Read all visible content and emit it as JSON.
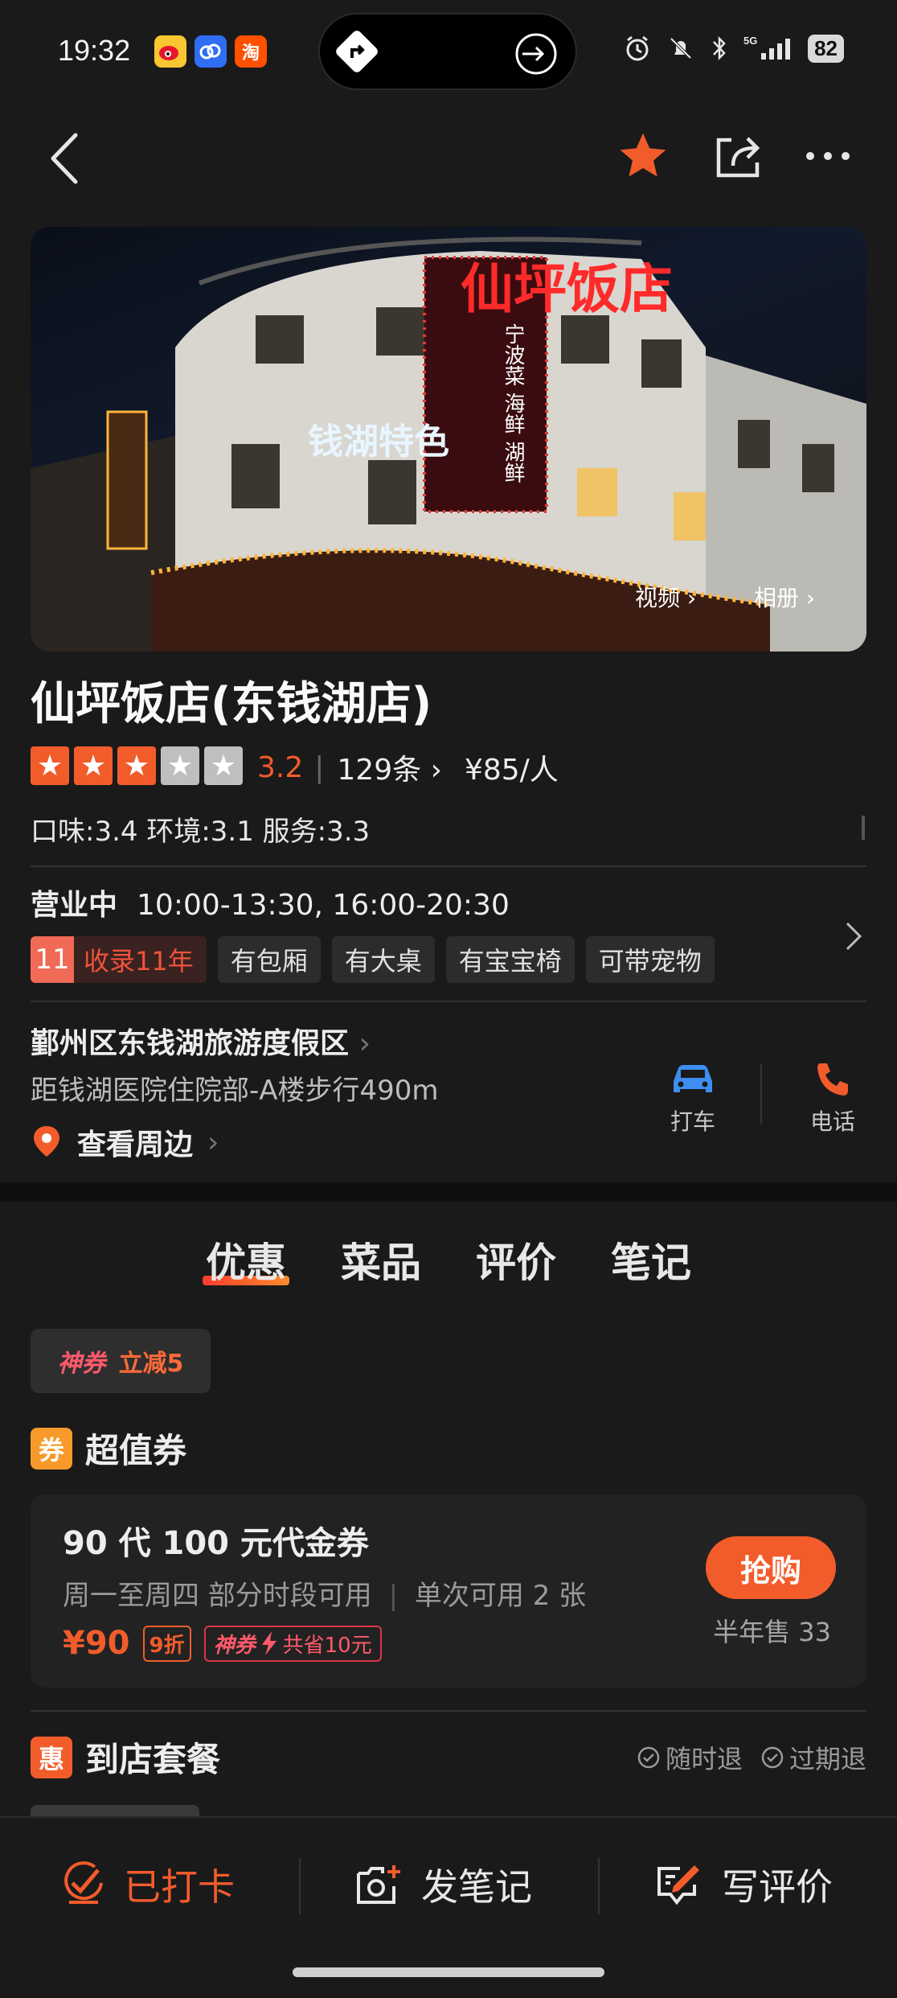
{
  "status_bar": {
    "time": "19:32",
    "app_icons": [
      "weibo-icon",
      "baidu-icon",
      "taobao-icon"
    ],
    "taobao_glyph": "淘",
    "battery": "82",
    "network": "5G"
  },
  "nav": {
    "favorited": true
  },
  "hero": {
    "video_label": "视频",
    "album_label": "相册",
    "sign_text": "仙坪饭店",
    "sign_sub": "宁波菜 海鲜 湖鲜",
    "banner_text": "钱湖特色"
  },
  "shop": {
    "name": "仙坪饭店(东钱湖店)",
    "rating": "3.2",
    "stars": 3,
    "review_count": "129条",
    "price": "¥85/人",
    "sub_scores": "口味:3.4  环境:3.1  服务:3.3",
    "status": "营业中",
    "hours": "10:00-13:30, 16:00-20:30",
    "tags": [
      {
        "num": "11",
        "label": "收录11年"
      },
      {
        "label": "有包厢"
      },
      {
        "label": "有大桌"
      },
      {
        "label": "有宝宝椅"
      },
      {
        "label": "可带宠物"
      }
    ],
    "address": "鄞州区东钱湖旅游度假区",
    "distance": "距钱湖医院住院部-A楼步行490m",
    "nearby": "查看周边",
    "taxi_label": "打车",
    "phone_label": "电话"
  },
  "tabs": [
    {
      "label": "优惠",
      "active": true
    },
    {
      "label": "菜品",
      "active": false
    },
    {
      "label": "评价",
      "active": false
    },
    {
      "label": "笔记",
      "active": false
    }
  ],
  "coupon_chip": {
    "brand": "神券",
    "offer": "立减5"
  },
  "voucher_section": {
    "badge": "券",
    "title": "超值券",
    "item": {
      "name": "90 代 100 元代金券",
      "availability": "周一至周四 部分时段可用",
      "limit": "单次可用 2 张",
      "price": "¥90",
      "discount": "9折",
      "coupon_brand": "神券",
      "savings": "共省10元",
      "buy_label": "抢购",
      "sold": "半年售 33"
    }
  },
  "package_section": {
    "badge": "惠",
    "title": "到店套餐",
    "refund_any": "随时退",
    "refund_expired": "过期退"
  },
  "bottom_bar": {
    "checkin": "已打卡",
    "post_note": "发笔记",
    "write_review": "写评价"
  },
  "colors": {
    "accent": "#f25c2b",
    "star": "#f25c2b",
    "bg": "#1a1a1a",
    "taxi": "#3d8ef0"
  }
}
